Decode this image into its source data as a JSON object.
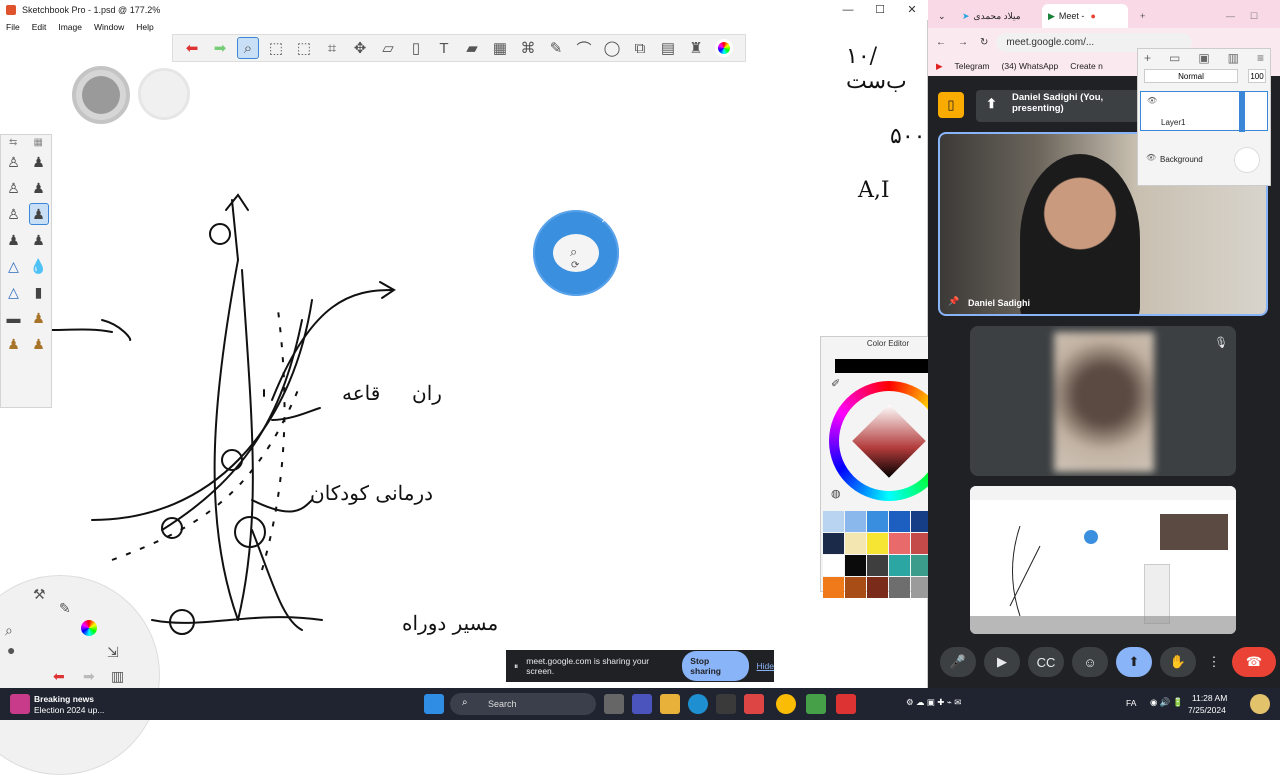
{
  "sketchbook": {
    "title": "Sketchbook Pro - 1.psd @ 177.2%",
    "window_controls": [
      "—",
      "☐",
      "✕"
    ],
    "menu": [
      "File",
      "Edit",
      "Image",
      "Window",
      "Help"
    ],
    "toolbar_icons": [
      "undo-icon",
      "redo-icon",
      "zoom-icon",
      "select-rect-icon",
      "select-lasso-icon",
      "crop-icon",
      "transform-icon",
      "distort-icon",
      "fill-icon",
      "text-icon",
      "ruler-icon",
      "perspective-icon",
      "symmetry-icon",
      "pen-icon",
      "curve-icon",
      "ellipse-icon",
      "shapes-icon",
      "layer-icon",
      "brush-library-icon",
      "color-wheel-icon"
    ],
    "share_bar": {
      "message": "meet.google.com is sharing your screen.",
      "stop_label": "Stop sharing",
      "hide_label": "Hide"
    }
  },
  "color_editor": {
    "title": "Color Editor",
    "swatches": [
      "#b8d4f0",
      "#8ab8ec",
      "#3a8ee0",
      "#1d5fc0",
      "#163e86",
      "#1b2a48",
      "#1b2a48",
      "#f4e6b0",
      "#f6e533",
      "#e86a6a",
      "#c44a4a",
      "#a12a2a",
      "#ffffff",
      "#0b0b0b",
      "#3e3e3e",
      "#2ca6a3",
      "#3c9c8b",
      "#8aa84a",
      "#f07a1a",
      "#a94d16",
      "#7a2b1a",
      "#6e6e6e",
      "#9b9b9b",
      "#b6b63a"
    ]
  },
  "browser": {
    "tabs": [
      {
        "label": "میلاد محمدی"
      },
      {
        "label": "Meet -"
      }
    ],
    "url": "meet.google.com/...",
    "bookmarks": [
      "Telegram",
      "(34) WhatsApp",
      "Create n"
    ]
  },
  "meet": {
    "presenting_banner": "Daniel Sadighi (You, presenting)",
    "main_tile_name": "Daniel Sadighi",
    "controls": [
      "mic-icon",
      "camera-icon",
      "captions-icon",
      "emoji-icon",
      "present-icon",
      "raise-hand-icon",
      "more-icon",
      "end-call-icon"
    ]
  },
  "layers": {
    "blend_mode": "Normal",
    "opacity": "100",
    "items": [
      "Layer1",
      "Background"
    ]
  },
  "taskbar": {
    "news_title": "Breaking news",
    "news_sub": "Election 2024 up...",
    "search_placeholder": "Search",
    "lang": "FA",
    "time": "11:28 AM",
    "date": "7/25/2024"
  }
}
